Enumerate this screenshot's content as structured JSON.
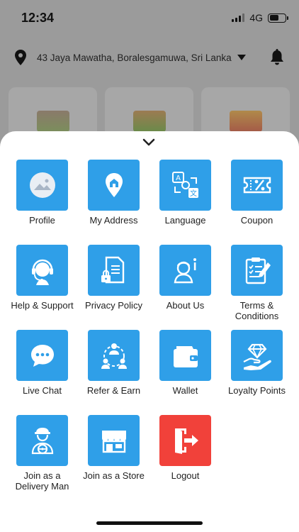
{
  "status_bar": {
    "time": "12:34",
    "network": "4G"
  },
  "header": {
    "address": "43 Jaya Mawatha, Boralesgamuwa, Sri Lanka"
  },
  "menu": {
    "items": [
      {
        "label": "Profile",
        "icon": "profile-image-icon"
      },
      {
        "label": "My Address",
        "icon": "home-pin-icon"
      },
      {
        "label": "Language",
        "icon": "translate-icon"
      },
      {
        "label": "Coupon",
        "icon": "coupon-icon"
      },
      {
        "label": "Help & Support",
        "icon": "headset-icon"
      },
      {
        "label": "Privacy Policy",
        "icon": "document-lock-icon"
      },
      {
        "label": "About Us",
        "icon": "person-info-icon"
      },
      {
        "label": "Terms & Conditions",
        "icon": "clipboard-check-icon"
      },
      {
        "label": "Live Chat",
        "icon": "chat-bubble-icon"
      },
      {
        "label": "Refer & Earn",
        "icon": "network-people-icon"
      },
      {
        "label": "Wallet",
        "icon": "wallet-icon"
      },
      {
        "label": "Loyalty Points",
        "icon": "diamond-hand-icon"
      },
      {
        "label": "Join as a Delivery Man",
        "icon": "delivery-man-icon"
      },
      {
        "label": "Join as a Store",
        "icon": "store-icon"
      },
      {
        "label": "Logout",
        "icon": "logout-icon"
      }
    ]
  },
  "colors": {
    "tile_blue": "#2f9fe8",
    "tile_red": "#f1413a"
  }
}
